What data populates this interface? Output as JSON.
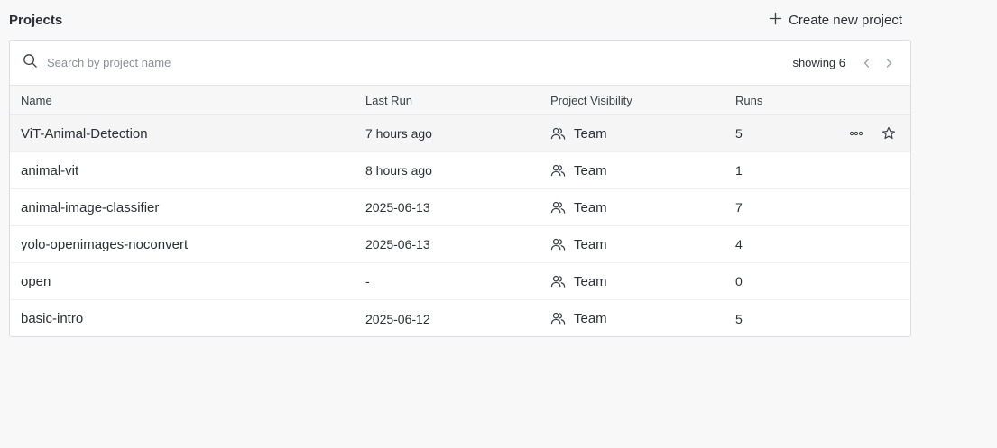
{
  "header": {
    "title": "Projects",
    "create_label": "Create new project"
  },
  "toolbar": {
    "search_placeholder": "Search by project name",
    "showing_label": "showing 6"
  },
  "table": {
    "columns": [
      "Name",
      "Last Run",
      "Project Visibility",
      "Runs"
    ],
    "rows": [
      {
        "name": "ViT-Animal-Detection",
        "last_run": "7 hours ago",
        "visibility": "Team",
        "runs": "5"
      },
      {
        "name": "animal-vit",
        "last_run": "8 hours ago",
        "visibility": "Team",
        "runs": "1"
      },
      {
        "name": "animal-image-classifier",
        "last_run": "2025-06-13",
        "visibility": "Team",
        "runs": "7"
      },
      {
        "name": "yolo-openimages-noconvert",
        "last_run": "2025-06-13",
        "visibility": "Team",
        "runs": "4"
      },
      {
        "name": "open",
        "last_run": "-",
        "visibility": "Team",
        "runs": "0"
      },
      {
        "name": "basic-intro",
        "last_run": "2025-06-12",
        "visibility": "Team",
        "runs": "5"
      }
    ]
  },
  "icons": {
    "search": "search-icon",
    "plus": "plus-icon",
    "prev": "chevron-left-icon",
    "next": "chevron-right-icon",
    "team": "team-icon",
    "more": "more-options-icon",
    "star": "star-icon"
  },
  "colors": {
    "background": "#f8f8f8",
    "card": "#ffffff",
    "text": "#2b2f36",
    "muted": "#8a8f98",
    "border": "#dcdde0"
  }
}
